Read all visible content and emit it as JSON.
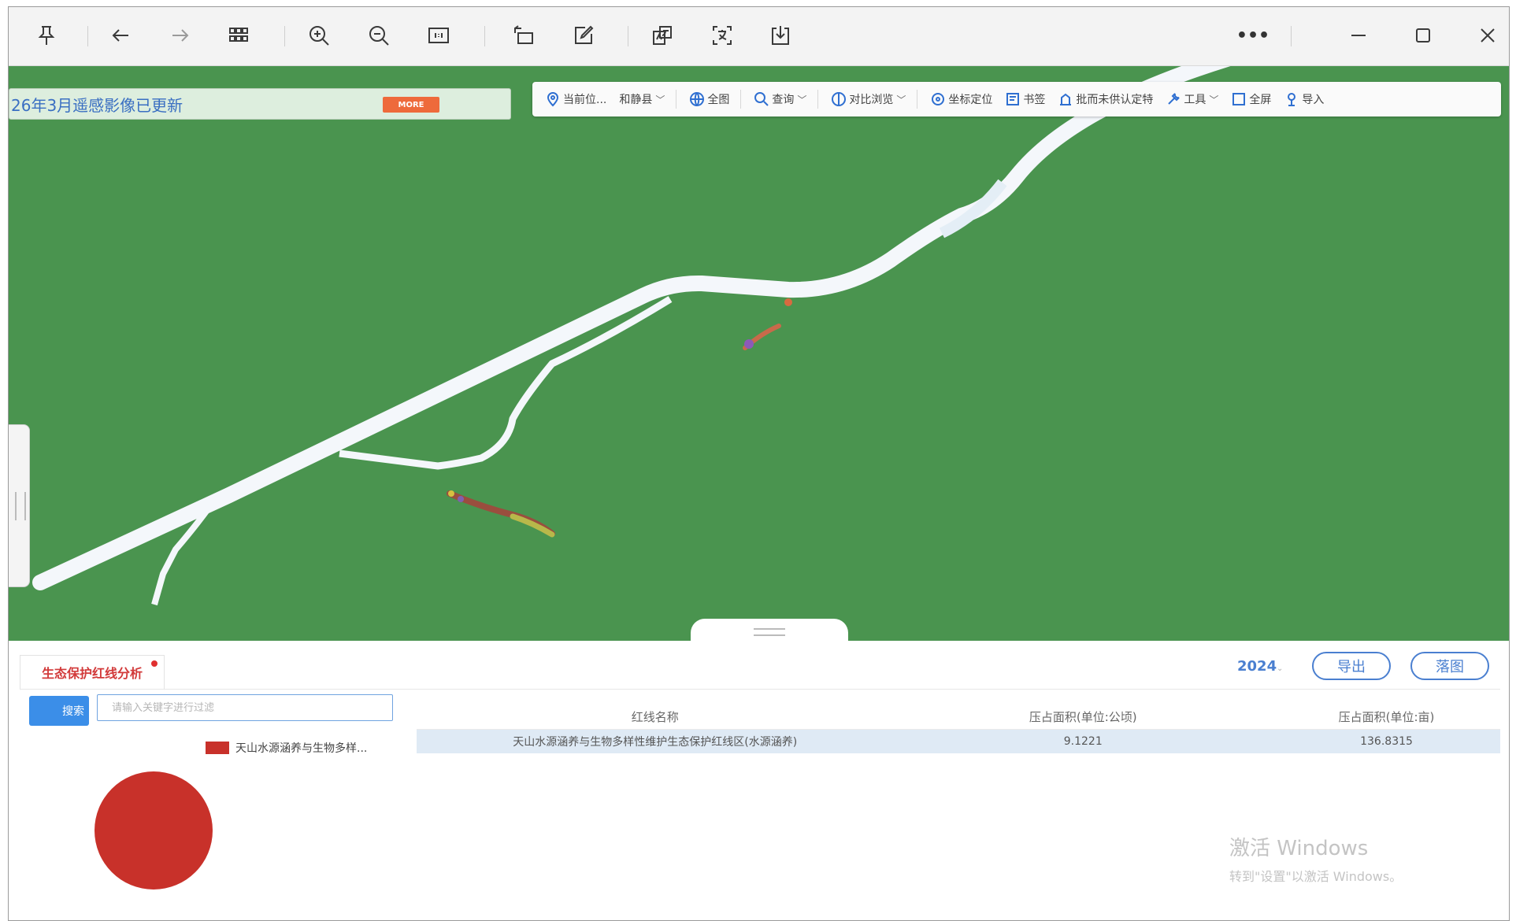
{
  "viewer_toolbar": {
    "icons": [
      "pin-icon",
      "back-arrow-icon",
      "forward-arrow-icon",
      "grid-icon",
      "zoom-in-icon",
      "zoom-out-icon",
      "actual-size-icon",
      "rotate-icon",
      "edit-icon",
      "translate-icon",
      "ocr-icon",
      "download-icon",
      "more-icon",
      "minimize-icon",
      "maximize-icon",
      "close-icon"
    ],
    "more": "•••"
  },
  "map": {
    "notice": "26年3月遥感影像已更新",
    "more_button": "MORE",
    "toolbar": {
      "location_label": "当前位...",
      "county": "和静县",
      "full_extent": "全图",
      "query": "查询",
      "compare": "对比浏览",
      "coordinate": "坐标定位",
      "bookmark": "书签",
      "unapproved": "批而未供认定特",
      "tools": "工具",
      "fullscreen": "全屏",
      "import": "导入"
    },
    "colors": {
      "land": "#4a944f",
      "river": "#f4f7fb"
    }
  },
  "panel": {
    "tab_label": "生态保护红线分析",
    "year": "2024",
    "export_button": "导出",
    "drawing_button": "落图",
    "search_button": "搜索",
    "search_placeholder": "请输入关键字进行过滤",
    "legend_label": "天山水源涵养与生物多样...",
    "legend_color": "#c8312a",
    "table": {
      "headers": [
        "红线名称",
        "压占面积(单位:公顷)",
        "压占面积(单位:亩)"
      ],
      "rows": [
        [
          "天山水源涵养与生物多样性维护生态保护红线区(水源涵养)",
          "9.1221",
          "136.8315"
        ]
      ]
    },
    "watermark": {
      "line1": "激活 Windows",
      "line2": "转到\"设置\"以激活 Windows。"
    }
  }
}
